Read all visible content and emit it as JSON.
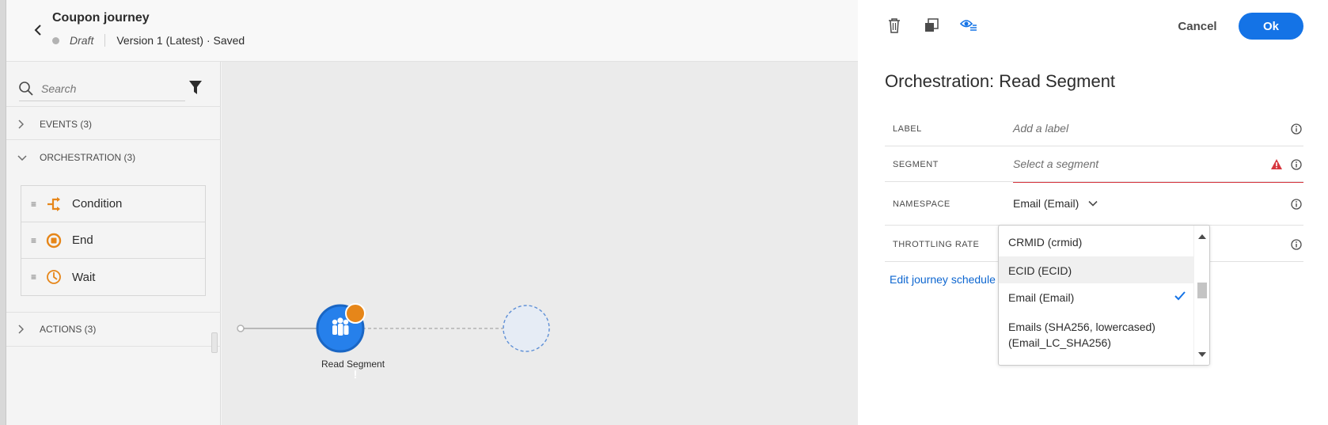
{
  "header": {
    "title": "Coupon journey",
    "status": "Draft",
    "version": "Version 1 (Latest) · Saved"
  },
  "palette": {
    "search_placeholder": "Search",
    "sections": {
      "events": "EVENTS (3)",
      "orchestration": "ORCHESTRATION (3)",
      "actions": "ACTIONS (3)"
    },
    "orchestration_items": [
      {
        "label": "Condition",
        "icon": "condition-icon"
      },
      {
        "label": "End",
        "icon": "end-icon"
      },
      {
        "label": "Wait",
        "icon": "wait-icon"
      }
    ]
  },
  "canvas": {
    "node_label": "Read Segment",
    "node_icon": "segment-icon",
    "node_badge": "!"
  },
  "panel": {
    "cancel_label": "Cancel",
    "ok_label": "Ok",
    "title": "Orchestration: Read Segment",
    "fields": {
      "label": {
        "name": "LABEL",
        "placeholder": "Add a label"
      },
      "segment": {
        "name": "SEGMENT",
        "placeholder": "Select a segment"
      },
      "namespace": {
        "name": "NAMESPACE",
        "value": "Email (Email)"
      },
      "throttling": {
        "name": "THROTTLING RATE"
      }
    },
    "edit_link": "Edit journey schedule",
    "namespace_options": [
      {
        "label": "CRMID (crmid)"
      },
      {
        "label": "ECID (ECID)"
      },
      {
        "label": "Email (Email)"
      },
      {
        "label": "Emails (SHA256, lowercased)",
        "label2": "(Email_LC_SHA256)"
      }
    ]
  },
  "colors": {
    "accent": "#1473e6",
    "orchestration_icon": "#e68619",
    "node_fill": "#2680eb",
    "warning": "#d7373f"
  }
}
